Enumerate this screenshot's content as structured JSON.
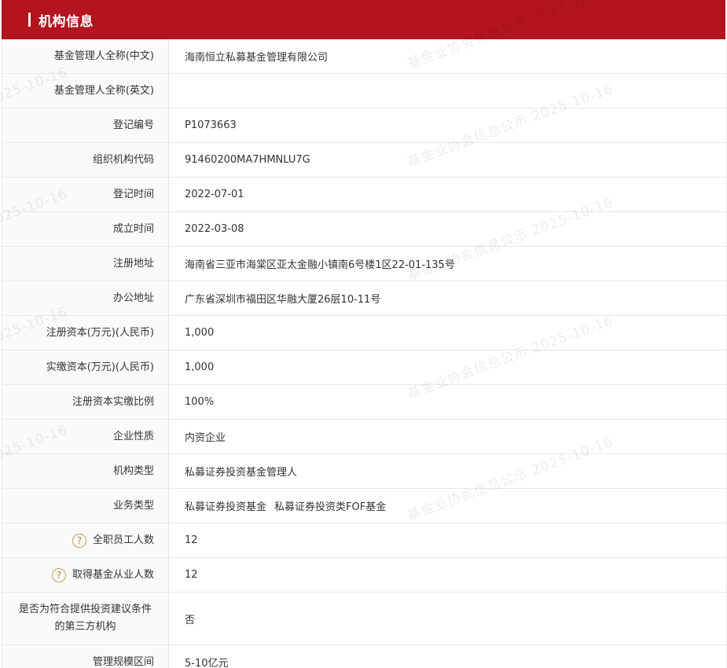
{
  "header": {
    "title": "机构信息"
  },
  "fields": [
    {
      "label": "基金管理人全称(中文)",
      "value": "海南恒立私募基金管理有限公司"
    },
    {
      "label": "基金管理人全称(英文)",
      "value": ""
    },
    {
      "label": "登记编号",
      "value": "P1073663"
    },
    {
      "label": "组织机构代码",
      "value": "91460200MA7HMNLU7G"
    },
    {
      "label": "登记时间",
      "value": "2022-07-01"
    },
    {
      "label": "成立时间",
      "value": "2022-03-08"
    },
    {
      "label": "注册地址",
      "value": "海南省三亚市海棠区亚太金融小镇南6号楼1区22-01-135号"
    },
    {
      "label": "办公地址",
      "value": "广东省深圳市福田区华融大厦26层10-11号"
    },
    {
      "label": "注册资本(万元)(人民币)",
      "value": "1,000"
    },
    {
      "label": "实缴资本(万元)(人民币)",
      "value": "1,000"
    },
    {
      "label": "注册资本实缴比例",
      "value": "100%"
    },
    {
      "label": "企业性质",
      "value": "内资企业"
    },
    {
      "label": "机构类型",
      "value": "私募证券投资基金管理人"
    },
    {
      "label": "业务类型",
      "value_items": [
        "私募证券投资基金",
        "私募证券投资类FOF基金"
      ]
    },
    {
      "label": "全职员工人数",
      "value": "12",
      "help": "?"
    },
    {
      "label": "取得基金从业人数",
      "value": "12",
      "help": "?"
    },
    {
      "label": "是否为符合提供投资建议条件的第三方机构",
      "label_lines": [
        "是否为符合提供投资建议条件",
        "的第三方机构"
      ],
      "value": "否"
    },
    {
      "label": "管理规模区间",
      "value": "5-10亿元"
    }
  ],
  "watermark": {
    "text_full": "基金业协会信息公示 2025-10-16",
    "text_date": "2025-10-16"
  },
  "colors": {
    "header_bg": "#b3141e",
    "label_bg": "#fafafa",
    "help_icon": "#b08838"
  }
}
